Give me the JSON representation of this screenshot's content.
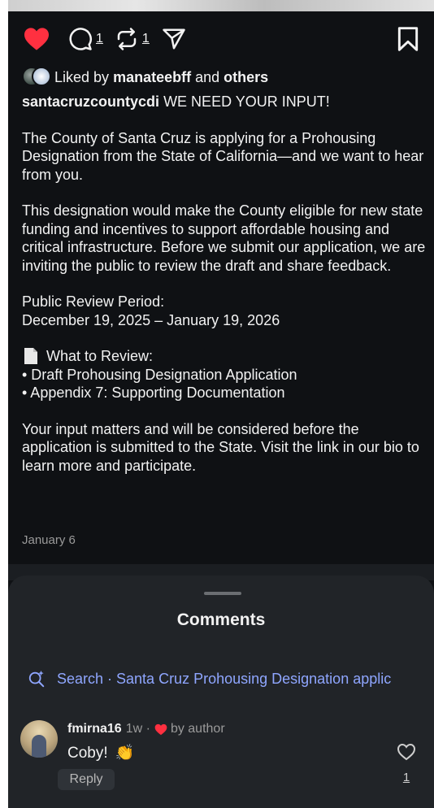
{
  "actions": {
    "comment_count": "1",
    "repost_count": "1",
    "liked": true,
    "like_color": "#ff3040"
  },
  "liked_by": {
    "prefix": "Liked by",
    "user": "manateebff",
    "connector": "and",
    "others": "others"
  },
  "caption": {
    "username": "santacruzcountycdi",
    "headline": "WE NEED YOUR INPUT!",
    "para1": "The County of Santa Cruz is applying for a Prohousing Designation from the State of California—and we want to hear from you.",
    "para2": "This designation would make the County eligible for new state funding and incentives to support affordable housing and critical infrastructure. Before we submit our application, we are inviting the public to review the draft and share feedback.",
    "review_period_label": "Public Review Period:",
    "review_period_dates": "December 19, 2025 – January 19, 2026",
    "what_to_review": "What to Review:",
    "item1": "• Draft Prohousing Designation Application",
    "item2": "• Appendix 7: Supporting Documentation",
    "para3": "Your input matters and will be considered before the application is submitted to the State. Visit the link in our bio to learn more and participate."
  },
  "post_date": "January 6",
  "comments_sheet": {
    "title": "Comments",
    "search_text": "Search · Santa Cruz Prohousing Designation applic",
    "accent_color": "#8fa6ff"
  },
  "comment": {
    "username": "fmirna16",
    "time": "1w ·",
    "by_author": "by author",
    "text": "Coby!",
    "emoji": "👏",
    "reply_label": "Reply",
    "like_count": "1"
  }
}
